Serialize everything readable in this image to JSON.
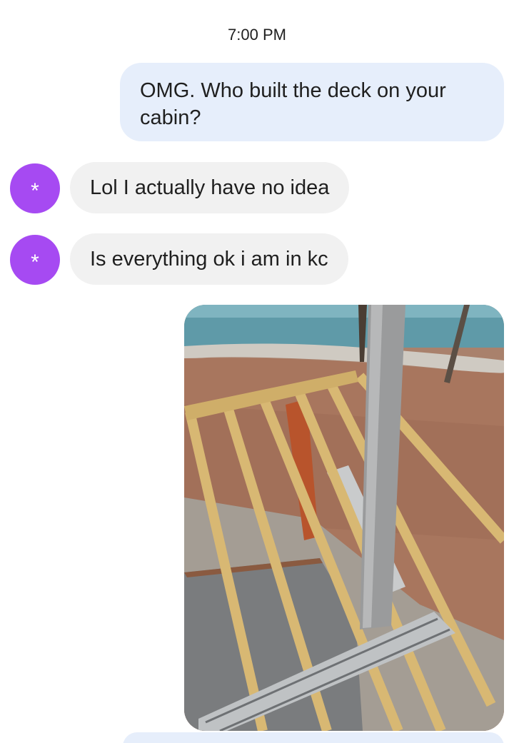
{
  "conversation": {
    "timestamp": "7:00 PM",
    "messages": [
      {
        "direction": "outgoing",
        "text": "OMG. Who built the deck on your cabin?"
      },
      {
        "direction": "incoming",
        "avatar": "*",
        "text": "Lol I actually have no idea"
      },
      {
        "direction": "incoming",
        "avatar": "*",
        "text": "Is everything ok i am in kc"
      },
      {
        "direction": "outgoing",
        "type": "image",
        "subject": "deck-construction-photo"
      }
    ]
  },
  "colors": {
    "outgoing_bubble": "#e6eefb",
    "incoming_bubble": "#f1f1f1",
    "avatar": "#a64af2",
    "text": "#1f1f1f"
  }
}
